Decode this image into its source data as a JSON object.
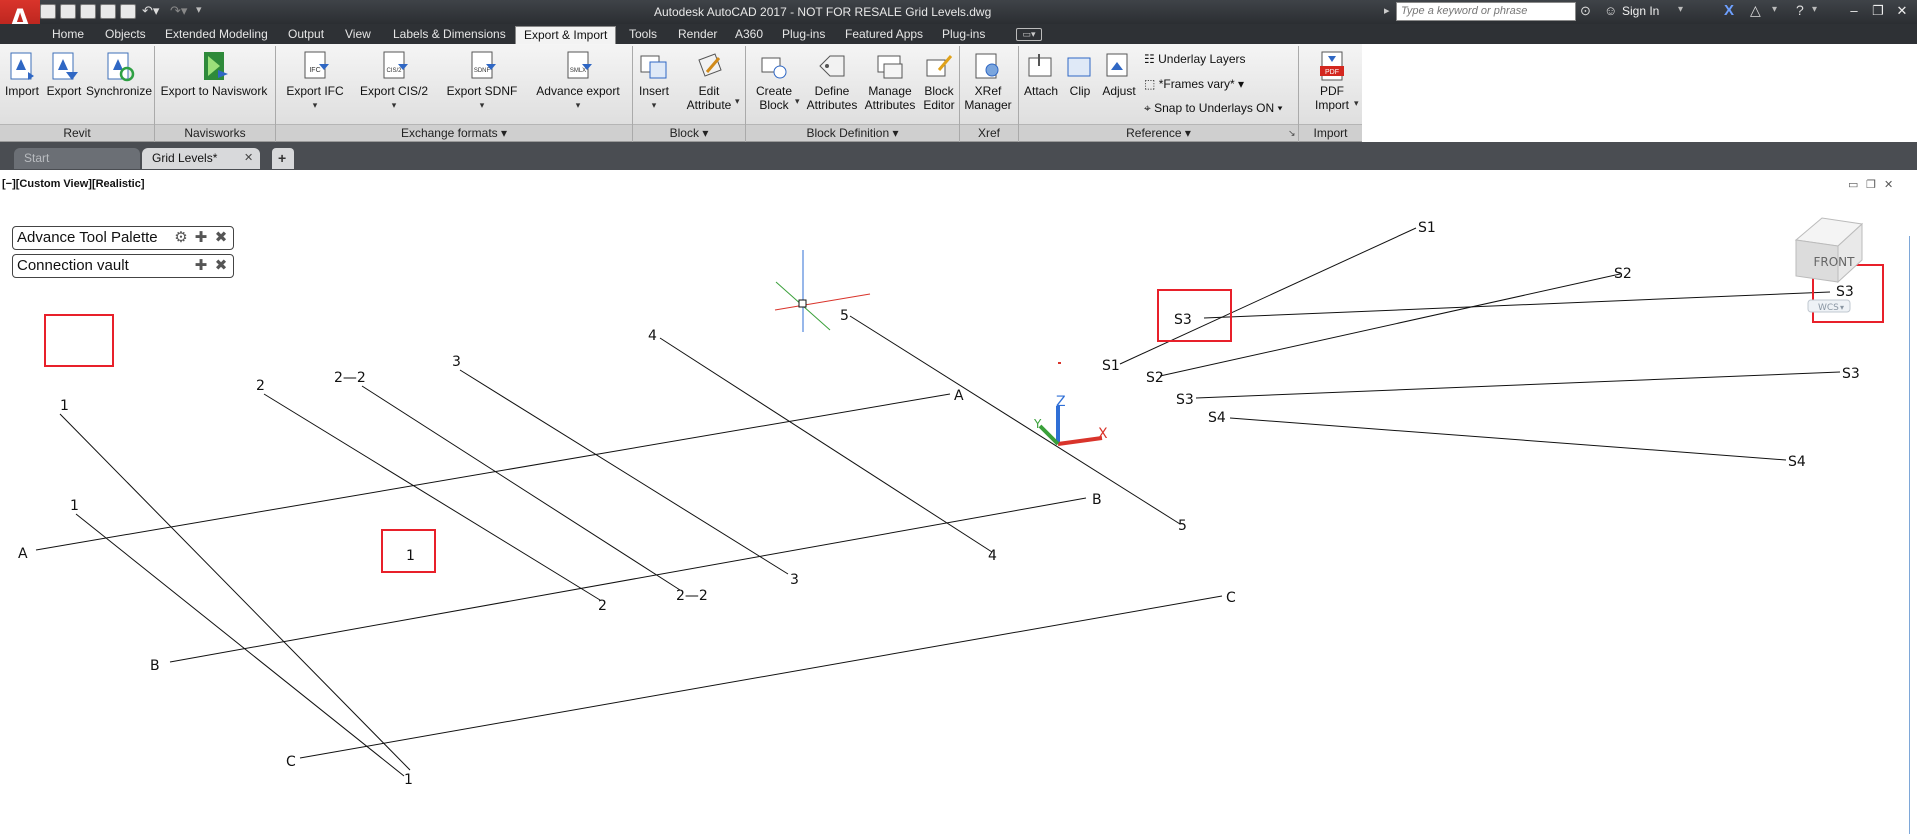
{
  "title_bar": {
    "title": "Autodesk AutoCAD 2017 - NOT FOR RESALE    Grid Levels.dwg",
    "search_placeholder": "Type a keyword or phrase",
    "sign_in": "Sign In",
    "logo_letter": "A"
  },
  "ribbon_tabs": [
    "Home",
    "Objects",
    "Extended Modeling",
    "Output",
    "View",
    "Labels & Dimensions",
    "Export & Import",
    "Tools",
    "Render",
    "A360",
    "Plug-ins",
    "Featured Apps",
    "Plug-ins"
  ],
  "ribbon": {
    "panels": {
      "revit": "Revit",
      "navisworks": "Navisworks",
      "exchange": "Exchange formats",
      "block": "Block",
      "block_def": "Block Definition",
      "xref": "Xref",
      "reference": "Reference",
      "import": "Import"
    },
    "buttons": {
      "import": "Import",
      "export": "Export",
      "synchronize": "Synchronize",
      "export_navisworks": "Export to Naviswork",
      "export_ifc": "Export IFC",
      "export_cis2": "Export CIS/2",
      "export_sdnf": "Export SDNF",
      "advance_export": "Advance export",
      "insert": "Insert",
      "edit_attr_1": "Edit",
      "edit_attr_2": "Attribute",
      "create_block_1": "Create",
      "create_block_2": "Block",
      "define_attr_1": "Define",
      "define_attr_2": "Attributes",
      "manage_attr_1": "Manage",
      "manage_attr_2": "Attributes",
      "block_editor_1": "Block",
      "block_editor_2": "Editor",
      "xref_manager_1": "XRef",
      "xref_manager_2": "Manager",
      "attach": "Attach",
      "clip": "Clip",
      "adjust": "Adjust",
      "underlay_layers": "Underlay Layers",
      "frames_vary": "*Frames vary*",
      "snap_underlays": "Snap to Underlays ON",
      "pdf_import_1": "PDF",
      "pdf_import_2": "Import"
    },
    "icon_labels": {
      "ifc": "IFC",
      "cis2": "CIS/2",
      "sdnf": "SDNF",
      "smlx": "SMLX",
      "pdf": "PDF"
    }
  },
  "doc_tabs": {
    "start": "Start",
    "active": "Grid Levels*",
    "add": "+"
  },
  "viewport": {
    "view_label": "[−][Custom View][Realistic]",
    "palettes": [
      "Advance Tool Palette",
      "Connection vault"
    ],
    "viewcube_face": "FRONT",
    "wcs": "WCS",
    "ucs_axes": {
      "x": "X",
      "y": "Y",
      "z": "Z"
    }
  },
  "grid_labels": {
    "a_left": "A",
    "a_right": "A",
    "b_left": "B",
    "b_right": "B",
    "c_left": "C",
    "c_right": "C",
    "g1_top": "1",
    "g1_bottom": "1",
    "g1p_top": "1",
    "g1p_bottom": "1",
    "g2_top": "2",
    "g2_bottom": "2",
    "g22_top": "2—2",
    "g22_bottom": "2—2",
    "g3_top": "3",
    "g3_bottom": "3",
    "g4_top": "4",
    "g4_bottom": "4",
    "g5_top": "5",
    "g5_bottom": "5",
    "s1_a": "S1",
    "s1_b": "S1",
    "s2_a": "S2",
    "s2_b": "S2",
    "s3_a": "S3",
    "s3_b": "S3",
    "s4_a": "S4",
    "s4_b": "S4",
    "s23_a": "S3",
    "s23_b": "S3"
  },
  "colors": {
    "highlight": "#e8202a",
    "ucs_x": "#d9342b",
    "ucs_y": "#3aa03a",
    "ucs_z": "#2f6fd6"
  }
}
